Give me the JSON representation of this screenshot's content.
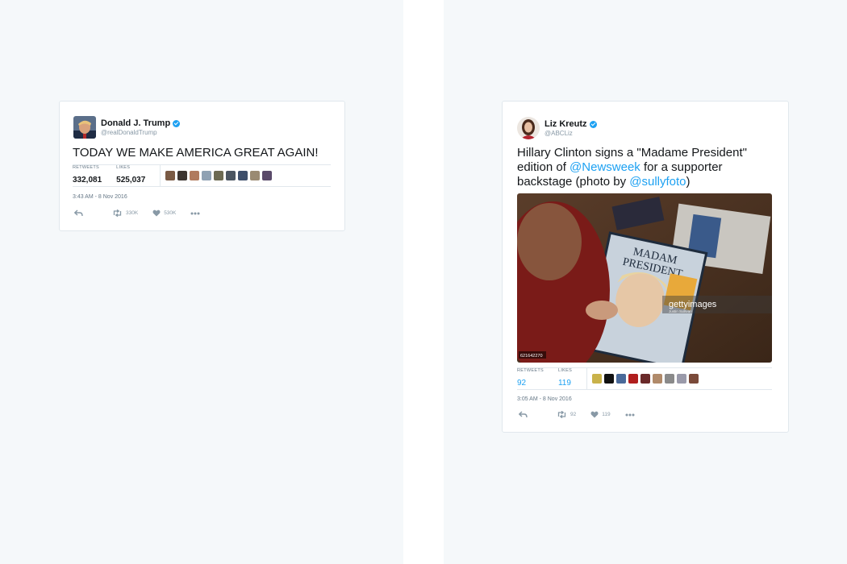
{
  "tweets": [
    {
      "name": "Donald J. Trump",
      "handle": "@realDonaldTrump",
      "text": "TODAY WE MAKE AMERICA GREAT AGAIN!",
      "retweets_label": "RETWEETS",
      "retweets": "332,081",
      "likes_label": "LIKES",
      "likes": "525,037",
      "time": "3:43 AM - 8 Nov 2016",
      "retweet_count": "330K",
      "like_count": "530K"
    },
    {
      "name": "Liz Kreutz",
      "handle": "@ABCLiz",
      "text_1": "Hillary Clinton signs a \"Madame President\" edition of ",
      "mention_1": "@Newsweek",
      "text_2": " for a supporter backstage (photo by ",
      "mention_2": "@sullyfoto",
      "text_3": ")",
      "photo_title_1": "MADAM",
      "photo_title_2": "PRESIDENT",
      "photo_watermark": "gettyimages",
      "photo_credit": "Justin Sullivan",
      "photo_id": "621642270",
      "retweets_label": "RETWEETS",
      "retweets": "92",
      "likes_label": "LIKES",
      "likes": "119",
      "time": "3:05 AM - 8 Nov 2016",
      "retweet_count": "92",
      "like_count": "119"
    }
  ],
  "colors": {
    "accent": "#1da1f2",
    "background": "#f5f8fa",
    "border": "#e1e8ed"
  }
}
